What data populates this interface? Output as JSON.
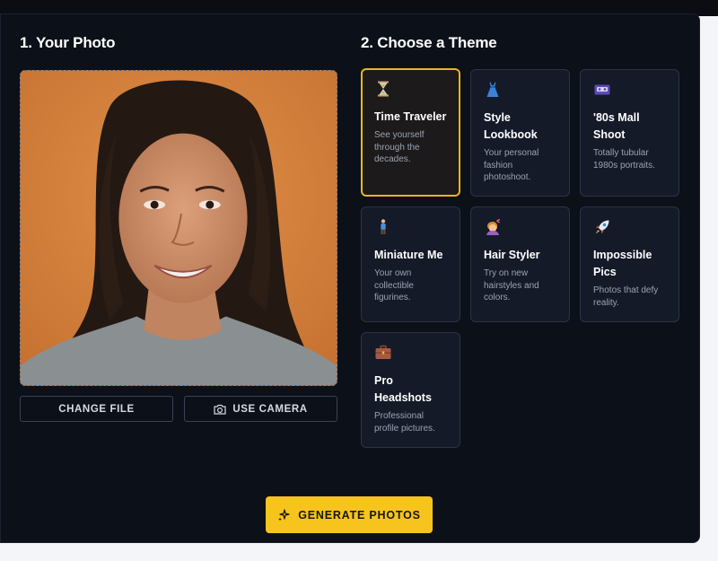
{
  "sections": {
    "photo_heading": "1. Your Photo",
    "theme_heading": "2. Choose a Theme"
  },
  "photo": {
    "change_file_label": "CHANGE FILE",
    "use_camera_label": "USE CAMERA",
    "camera_icon": "camera-icon"
  },
  "themes": [
    {
      "title": "Time Traveler",
      "desc": "See yourself through the decades.",
      "icon": "hourglass-icon",
      "selected": true
    },
    {
      "title": "Style Lookbook",
      "desc": "Your personal fashion photoshoot.",
      "icon": "dress-icon",
      "selected": false
    },
    {
      "title": "'80s Mall Shoot",
      "desc": "Totally tubular 1980s portraits.",
      "icon": "cassette-icon",
      "selected": false
    },
    {
      "title": "Miniature Me",
      "desc": "Your own collectible figurines.",
      "icon": "figurine-icon",
      "selected": false
    },
    {
      "title": "Hair Styler",
      "desc": "Try on new hairstyles and colors.",
      "icon": "haircut-icon",
      "selected": false
    },
    {
      "title": "Impossible Pics",
      "desc": "Photos that defy reality.",
      "icon": "rocket-icon",
      "selected": false
    },
    {
      "title": "Pro Headshots",
      "desc": "Professional profile pictures.",
      "icon": "briefcase-icon",
      "selected": false
    }
  ],
  "generate": {
    "label": "GENERATE PHOTOS",
    "icon": "sparkles-icon"
  },
  "colors": {
    "panel_bg": "#0c1018",
    "card_bg": "#141a28",
    "accent": "#f7c31d",
    "selected_border": "#e7b722"
  }
}
